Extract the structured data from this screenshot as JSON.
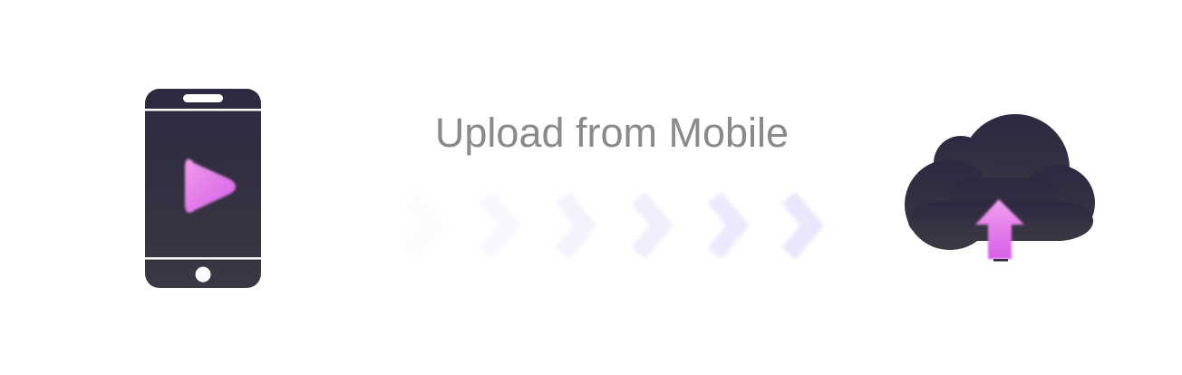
{
  "upload": {
    "title": "Upload from Mobile"
  },
  "icons": {
    "phone": "smartphone-video-icon",
    "play": "play-icon",
    "arrows": "chevron-right-icon",
    "cloud": "cloud-upload-icon",
    "upload_arrow": "arrow-up-icon"
  },
  "colors": {
    "icon_dark": "#2e2a3d",
    "accent_light": "#f290ef",
    "accent_dark": "#d35fe6",
    "chevron": "#ece8fb",
    "title_text": "#8a8a8a"
  }
}
